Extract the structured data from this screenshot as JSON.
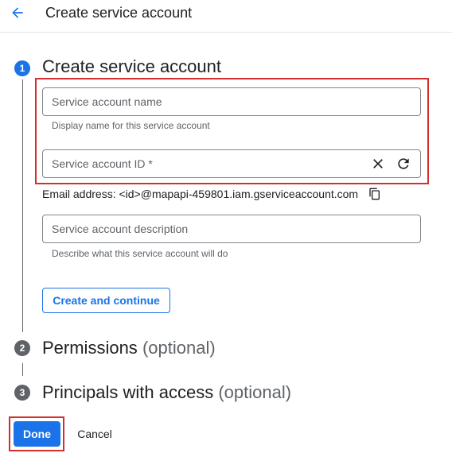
{
  "header": {
    "title": "Create service account",
    "back_icon": "arrow-back-icon"
  },
  "steps": [
    {
      "number": "1",
      "title": "Create service account",
      "optional": "",
      "state": "active"
    },
    {
      "number": "2",
      "title": "Permissions",
      "optional": "(optional)",
      "state": "inactive"
    },
    {
      "number": "3",
      "title": "Principals with access",
      "optional": "(optional)",
      "state": "inactive"
    }
  ],
  "form": {
    "name_field": {
      "placeholder": "Service account name",
      "value": "",
      "helper": "Display name for this service account"
    },
    "id_field": {
      "placeholder": "Service account ID *",
      "value": "",
      "clear_icon": "close-icon",
      "generate_icon": "refresh-icon"
    },
    "email": {
      "text": "Email address: <id>@mapapi-459801.iam.gserviceaccount.com",
      "copy_icon": "copy-icon"
    },
    "description_field": {
      "placeholder": "Service account description",
      "value": "",
      "helper": "Describe what this service account will do"
    },
    "create_button": "Create and continue"
  },
  "footer": {
    "done_button": "Done",
    "cancel_button": "Cancel"
  },
  "colors": {
    "accent": "#1a73e8",
    "highlight": "#d32f2f",
    "inactive_step": "#5f6368"
  }
}
